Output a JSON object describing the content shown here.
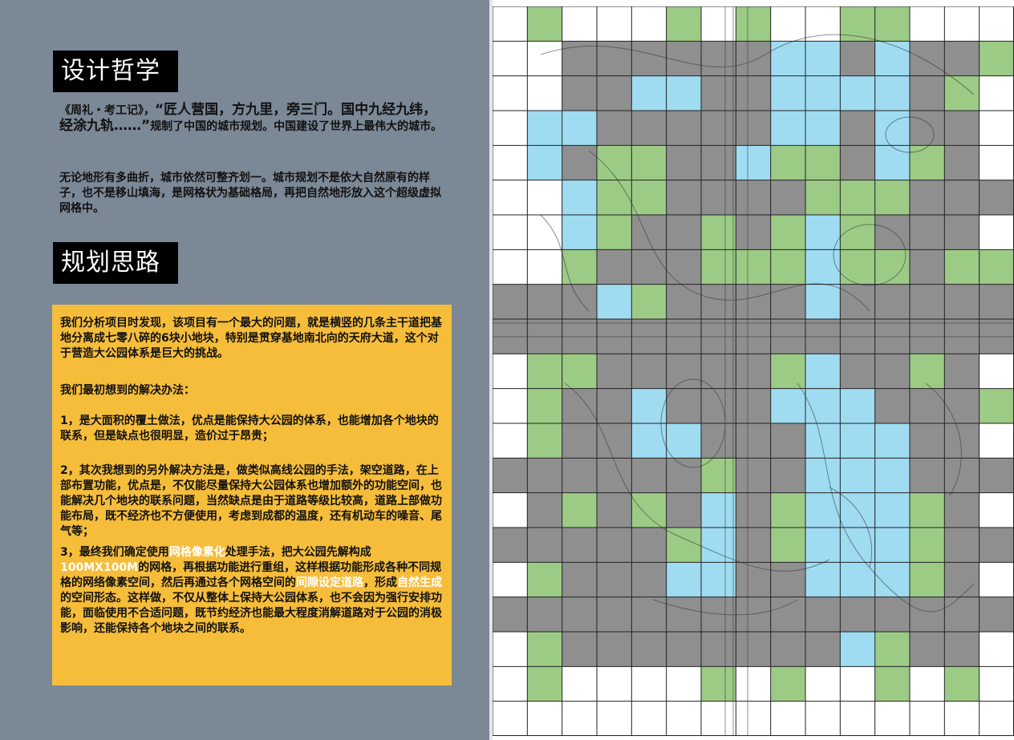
{
  "philosophy": {
    "heading": "设计哲学",
    "p1_prefix": "《周礼・考工记》，",
    "p1_quote": "“匠人营国，方九里，旁三门。国中九经九纬，经涂九轨……”",
    "p1_suffix": "规制了中国的城市规划。中国建设了世界上最伟大的城市。",
    "p2": "无论地形有多曲折，城市依然可整齐划一。城市规划不是依大自然原有的样子，也不是移山填海，是网格状为基础格局，再把自然地形放入这个超级虚拟网格中。"
  },
  "planning": {
    "heading": "规划思路",
    "box_bg": "#f6bd3b",
    "p1": "我们分析项目时发现，该项目有一个最大的问题，就是横竖的几条主干道把基地分离成七零八碎的6块小地块，特别是贯穿基地南北向的天府大道，这个对于营造大公园体系是巨大的挑战。",
    "p2": "我们最初想到的解决办法：",
    "p3": "1，是大面积的覆土做法，优点是能保持大公园的体系，也能增加各个地块的联系，但是缺点也很明显，造价过于昂贵；",
    "p4": "2，其次我想到的另外解决方法是，做类似高线公园的手法，架空道路，在上部布置功能，优点是，不仅能尽量保持大公园体系也增加额外的功能空间，也能解决几个地块的联系问题，当然缺点是由于道路等级比较高，道路上部做功能布局，既不经济也不方便使用，考虑到成都的温度，还有机动车的噪音、尾气等；",
    "p5_a": "3，最终我们确定使用",
    "p5_hl1": "网格像素化",
    "p5_b": "处理手法，把大公园先解构成",
    "p5_hl2": "100MX100M",
    "p5_c": "的网格，再根据功能进行重组，这样根据功能形成各种不同规格的网络像素空间，然后再通过各个网格空间的",
    "p5_hl3": "间隙设定道路",
    "p5_d": "，形成",
    "p5_hl4": "自然生成",
    "p5_e": "的空间形态。这样做，不仅从整体上保持大公园体系，也不会因为强行安排功能，面临使用不合适问题，既节约经济也能最大程度消解道路对于公园的消极影响，还能保持各个地块之间的联系。"
  },
  "grid_map": {
    "colors": {
      "G": "#9ccb86",
      "B": "#9fdcf2",
      "D": "#8f8f8f",
      "W": "#ffffff",
      "line": "#222222"
    },
    "cols": 15,
    "rows": 21,
    "cells": [
      "WGWWWGWGWWGGWWW",
      "WWDDDDDDBBDBDDG",
      "WWDDBBDDBBBBDGW",
      "WBBDDDDDBBDBDDW",
      "WBDGGDDBGGDBGDW",
      "WWBGGDDDDGGGDDD",
      "WWBGDDGDGBGDDDW",
      "WWGDDDGGGBGGDGG",
      "DDDBGDDDDBDDDDD",
      "DDDDDDDDDDDDDDD",
      "WGGDDDDDGBDDGDW",
      "WGDDBDDDBBBDDDG",
      "WGDDBBDDDBBBDDW",
      "DDDDDDGDDBBBDDD",
      "WDGDGDBDGBBBGDW",
      "DDDDDGBDGBBBGDD",
      "WGDDDBBDDBBBGDW",
      "DDDDDDDDDDDDDDD",
      "WGDDDDDDDDBGDDW",
      "WGWWWWGWGWWGWGW",
      "WWWWWWWWWWWWWWW"
    ]
  }
}
